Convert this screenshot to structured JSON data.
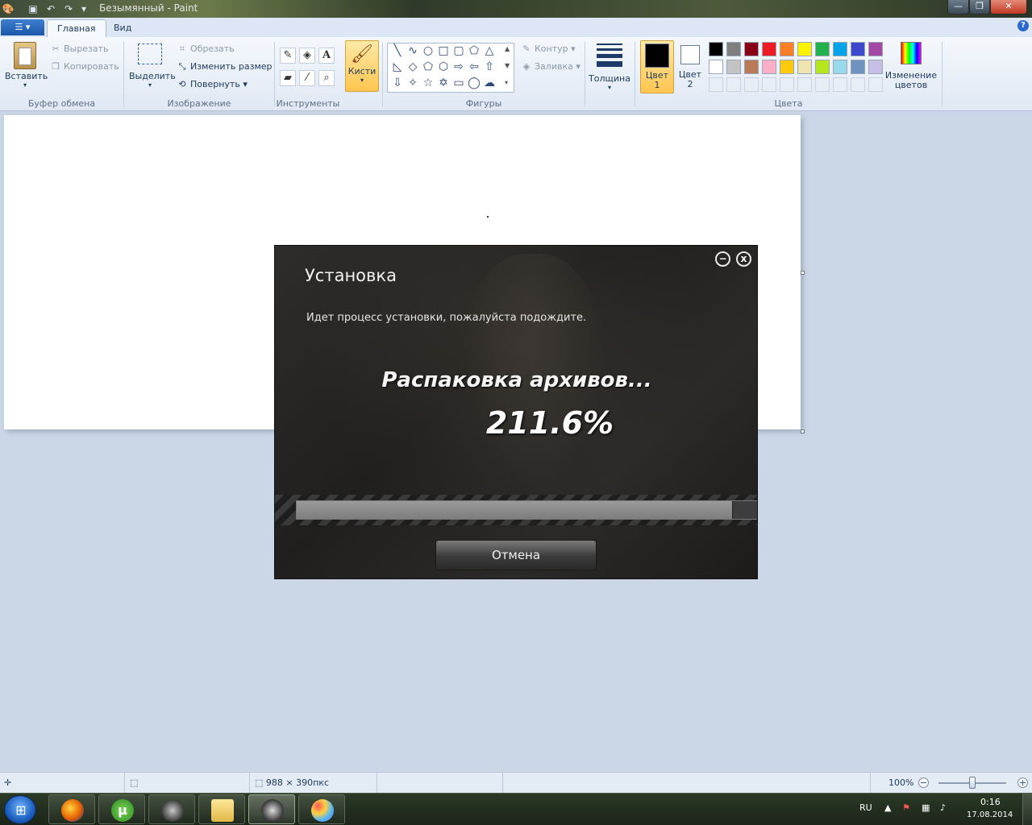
{
  "window": {
    "title": "Безымянный - Paint",
    "controls": {
      "minimize": "—",
      "maximize": "❐",
      "close": "✕"
    }
  },
  "tabs": [
    "Главная",
    "Вид"
  ],
  "clipboard": {
    "paste": "Вставить",
    "cut": "Вырезать",
    "copy": "Копировать",
    "group": "Буфер обмена"
  },
  "image": {
    "select": "Выделить",
    "crop": "Обрезать",
    "resize": "Изменить размер",
    "rotate": "Повернуть",
    "group": "Изображение"
  },
  "tools": {
    "group": "Инструменты"
  },
  "brushes": {
    "label": "Кисти"
  },
  "shapes": {
    "outline": "Контур",
    "fill": "Заливка",
    "group": "Фигуры"
  },
  "thickness": {
    "label": "Толщина"
  },
  "colors": {
    "color1": "Цвет",
    "color1_num": "1",
    "color2": "Цвет",
    "color2_num": "2",
    "edit": "Изменение",
    "edit2": "цветов",
    "group": "Цвета",
    "primary": "#000000",
    "secondary": "#ffffff",
    "palette_row1": [
      "#000000",
      "#7f7f7f",
      "#880015",
      "#ed1c24",
      "#ff7f27",
      "#fff200",
      "#22b14c",
      "#00a2e8",
      "#3f48cc",
      "#a349a4"
    ],
    "palette_row2": [
      "#ffffff",
      "#c3c3c3",
      "#b97a57",
      "#ffaec9",
      "#ffc90e",
      "#efe4b0",
      "#b5e61d",
      "#99d9ea",
      "#7092be",
      "#c8bfe7"
    ]
  },
  "installer": {
    "title": "Установка",
    "subtitle": "Идет процесс установки, пожалуйста подождите.",
    "status": "Распаковка архивов...",
    "percent": "211.6%",
    "progress": 0.945,
    "cancel": "Отмена",
    "minimize": "−",
    "close": "x"
  },
  "statusbar": {
    "size": "988 × 390пкс",
    "zoom": "100%",
    "zoom_level": 0.5
  },
  "taskbar": {
    "lang": "RU",
    "time": "0:16",
    "date": "17.08.2014"
  }
}
